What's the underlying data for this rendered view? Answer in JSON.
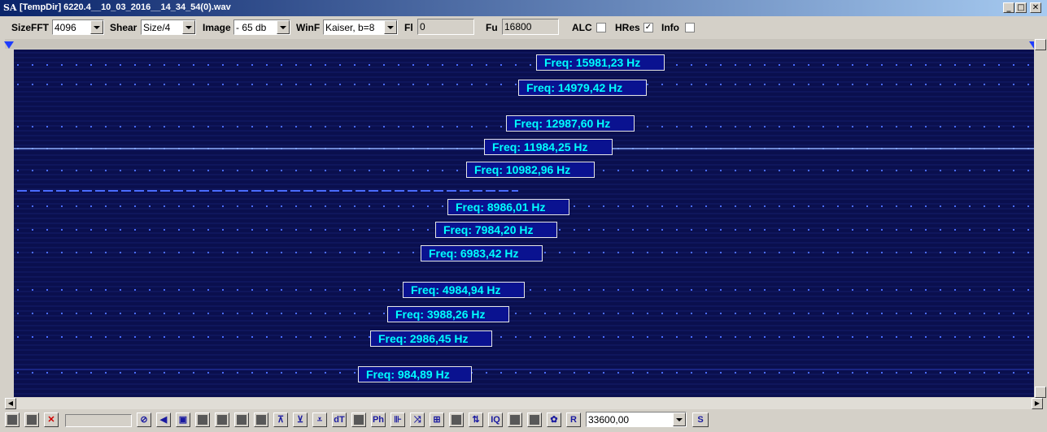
{
  "window": {
    "icon": "SA",
    "title": "[TempDir] 6220.4__10_03_2016__14_34_54(0).wav",
    "controls": [
      "minimize-icon",
      "maximize-icon",
      "close-icon"
    ]
  },
  "toolbar": {
    "sizefft_label": "SizeFFT",
    "sizefft_value": "4096",
    "shear_label": "Shear",
    "shear_value": "Size/4",
    "image_label": "Image",
    "image_value": "- 65 db",
    "winf_label": "WinF",
    "winf_value": "Kaiser, b=8",
    "fl_label": "Fl",
    "fl_value": "0",
    "fu_label": "Fu",
    "fu_value": "16800",
    "alc_label": "ALC",
    "alc_checked": false,
    "hres_label": "HRes",
    "hres_checked": true,
    "info_label": "Info",
    "info_checked": false
  },
  "spectrum": {
    "background": "#0a0f4e",
    "trace_color": "#4a6cff",
    "label_text_color": "#00ffff",
    "peaks": [
      {
        "label": "Freq: 15981,23 Hz"
      },
      {
        "label": "Freq: 14979,42 Hz"
      },
      {
        "label": "Freq: 12987,60 Hz"
      },
      {
        "label": "Freq: 11984,25 Hz"
      },
      {
        "label": "Freq: 10982,96 Hz"
      },
      {
        "label": "Freq: 8986,01 Hz"
      },
      {
        "label": "Freq: 7984,20 Hz"
      },
      {
        "label": "Freq: 6983,42 Hz"
      },
      {
        "label": "Freq: 4984,94 Hz"
      },
      {
        "label": "Freq: 3988,26 Hz"
      },
      {
        "label": "Freq: 2986,45 Hz"
      },
      {
        "label": "Freq: 984,89 Hz"
      }
    ]
  },
  "bottom_toolbar": {
    "buttons": [
      {
        "name": "gray-square-icon",
        "glyph": ""
      },
      {
        "name": "gray-square-icon",
        "glyph": ""
      },
      {
        "name": "red-x-icon",
        "glyph": "✕"
      },
      {
        "name": "no-entry-icon",
        "glyph": "⊘"
      },
      {
        "name": "speaker-icon",
        "glyph": "◀"
      },
      {
        "name": "frame-icon",
        "glyph": "▣"
      },
      {
        "name": "gray-square-icon",
        "glyph": ""
      },
      {
        "name": "gray-square-icon",
        "glyph": ""
      },
      {
        "name": "gray-square-icon",
        "glyph": ""
      },
      {
        "name": "gray-square-icon",
        "glyph": ""
      },
      {
        "name": "arrow-up-peak-icon",
        "glyph": "⊼"
      },
      {
        "name": "arrow-down-peak-icon",
        "glyph": "⊻"
      },
      {
        "name": "double-arrow-icon",
        "glyph": "⩡"
      },
      {
        "name": "dt-icon",
        "glyph": "dT"
      },
      {
        "name": "gray-square-icon",
        "glyph": ""
      },
      {
        "name": "ph-icon",
        "glyph": "Ph"
      },
      {
        "name": "comb-icon",
        "glyph": "⊪"
      },
      {
        "name": "cross-arrows-icon",
        "glyph": "⤨"
      },
      {
        "name": "grid-icon",
        "glyph": "⊞"
      },
      {
        "name": "gray-square-icon",
        "glyph": ""
      },
      {
        "name": "updown-arrows-icon",
        "glyph": "⇅"
      },
      {
        "name": "iq-icon",
        "glyph": "IQ"
      },
      {
        "name": "gray-square-icon",
        "glyph": ""
      },
      {
        "name": "gray-square-icon",
        "glyph": ""
      },
      {
        "name": "gear-icon",
        "glyph": "✿"
      },
      {
        "name": "copy-icon",
        "glyph": "⧉"
      },
      {
        "name": "r-icon",
        "glyph": "R"
      }
    ],
    "rate_value": "33600,00",
    "s_button": "S"
  }
}
